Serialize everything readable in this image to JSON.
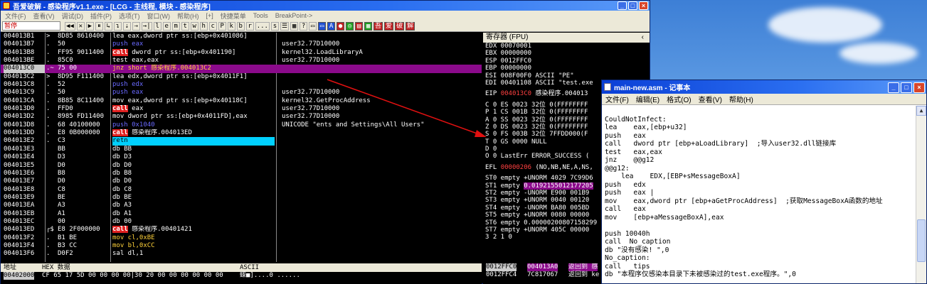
{
  "olly": {
    "title": "吾爱破解 - 感染程序v1.1.exe - [LCG - 主线程, 模块 - 感染程序]",
    "menu": [
      "文件(F)",
      "查看(V)",
      "调试(D)",
      "插件(P)",
      "选项(T)",
      "窗口(W)",
      "帮助(H)",
      "[+]",
      "快捷菜单",
      "Tools",
      "BreakPoint->"
    ],
    "status": "暂停",
    "toolbar": [
      "◀◀",
      "✕",
      "▶",
      "⏸",
      "↳",
      "↴",
      "⇣",
      "⇢",
      "→|",
      "l",
      "e",
      "m",
      "t",
      "w",
      "h",
      "c",
      "P",
      "k",
      "b",
      "r",
      "...",
      "s",
      "☰",
      "▦",
      "?",
      "▭",
      "▭",
      "A",
      "●",
      "◎",
      "▤",
      "▦",
      "吾",
      "爱",
      "破",
      "解"
    ],
    "disasm": [
      {
        "addr": "004013B1",
        "mk": ">",
        "hex": "8D85 8610400",
        "asm": "lea eax,dword ptr ss:[ebp+0x401086]",
        "cmt": ""
      },
      {
        "addr": "004013B7",
        "mk": ".",
        "hex": "50",
        "asm": "push eax",
        "cmt": "user32.77D10000"
      },
      {
        "addr": "004013B8",
        "mk": ".",
        "hex": "FF95 9011400",
        "asm": "call dword ptr ss:[ebp+0x401190]",
        "cmt": "kernel32.LoadLibraryA"
      },
      {
        "addr": "004013BE",
        "mk": ".",
        "hex": "85C0",
        "asm": "test eax,eax",
        "cmt": "user32.77D10000"
      },
      {
        "addr": "004013C0",
        "mk": ".~",
        "hex": "75 00",
        "asm": "jnz short 感染程序.004013C2",
        "cmt": ""
      },
      {
        "addr": "004013C2",
        "mk": ">",
        "hex": "8D95 F111400",
        "asm": "lea edx,dword ptr ss:[ebp+0x4011F1]",
        "cmt": ""
      },
      {
        "addr": "004013C8",
        "mk": ".",
        "hex": "52",
        "asm": "push edx",
        "cmt": ""
      },
      {
        "addr": "004013C9",
        "mk": ".",
        "hex": "50",
        "asm": "push eax",
        "cmt": "user32.77D10000"
      },
      {
        "addr": "004013CA",
        "mk": ".",
        "hex": "8B85 8C11400",
        "asm": "mov eax,dword ptr ss:[ebp+0x40118C]",
        "cmt": "kernel32.GetProcAddress"
      },
      {
        "addr": "004013D0",
        "mk": ".",
        "hex": "FFD0",
        "asm": "call eax",
        "cmt": "user32.77D10000"
      },
      {
        "addr": "004013D2",
        "mk": ".",
        "hex": "8985 FD11400",
        "asm": "mov dword ptr ss:[ebp+0x4011FD],eax",
        "cmt": "user32.77D10000"
      },
      {
        "addr": "004013D8",
        "mk": ".",
        "hex": "68 40100000",
        "asm": "push 0x1040",
        "cmt": "UNICODE \"ents and Settings\\All Users\""
      },
      {
        "addr": "004013DD",
        "mk": ".",
        "hex": "E8 0B000000",
        "asm": "call 感染程序.004013ED",
        "cmt": ""
      },
      {
        "addr": "004013E2",
        "mk": ".",
        "hex": "C3",
        "asm": "retn",
        "cmt": ""
      },
      {
        "addr": "004013E3",
        "mk": "",
        "hex": "BB",
        "asm": "db BB",
        "cmt": ""
      },
      {
        "addr": "004013E4",
        "mk": "",
        "hex": "D3",
        "asm": "db D3",
        "cmt": ""
      },
      {
        "addr": "004013E5",
        "mk": "",
        "hex": "D0",
        "asm": "db D0",
        "cmt": ""
      },
      {
        "addr": "004013E6",
        "mk": "",
        "hex": "B8",
        "asm": "db B8",
        "cmt": ""
      },
      {
        "addr": "004013E7",
        "mk": "",
        "hex": "D0",
        "asm": "db D0",
        "cmt": ""
      },
      {
        "addr": "004013E8",
        "mk": "",
        "hex": "C8",
        "asm": "db C8",
        "cmt": ""
      },
      {
        "addr": "004013E9",
        "mk": "",
        "hex": "BE",
        "asm": "db BE",
        "cmt": ""
      },
      {
        "addr": "004013EA",
        "mk": "",
        "hex": "A3",
        "asm": "db A3",
        "cmt": ""
      },
      {
        "addr": "004013EB",
        "mk": "",
        "hex": "A1",
        "asm": "db A1",
        "cmt": ""
      },
      {
        "addr": "004013EC",
        "mk": "",
        "hex": "00",
        "asm": "db 00",
        "cmt": ""
      },
      {
        "addr": "004013ED",
        "mk": "┌$",
        "hex": "E8 2F000000",
        "asm": "call 感染程序.00401421",
        "cmt": ""
      },
      {
        "addr": "004013F2",
        "mk": ".",
        "hex": "B1 BE",
        "asm": "mov cl,0xBE",
        "cmt": ""
      },
      {
        "addr": "004013F4",
        "mk": ".",
        "hex": "B3 CC",
        "asm": "mov bl,0xCC",
        "cmt": ""
      },
      {
        "addr": "004013F6",
        "mk": ".",
        "hex": "D0F2",
        "asm": "sal dl,1",
        "cmt": ""
      }
    ],
    "regs_title": "寄存器 (FPU)",
    "regs": [
      "EDX 00070001",
      "EBX 00000000",
      "ESP 0012FFC0",
      "EBP 00000000",
      "ESI 008F00F0 ASCII \"PE\"",
      "EDI 00401108 ASCII \"test.exe",
      "",
      "EIP 004013C0 感染程序.004013",
      "",
      "C 0  ES 0023 32位 0(FFFFFFFF",
      "P 1  CS 001B 32位 0(FFFFFFFF",
      "A 0  SS 0023 32位 0(FFFFFFFF",
      "Z 0  DS 0023 32位 0(FFFFFFFF",
      "S 0  FS 003B 32位 7FFDD000(F",
      "T 0  GS 0000 NULL",
      "D 0",
      "O 0  LastErr ERROR_SUCCESS (",
      "",
      "EFL 00000206 (NO,NB,NE,A,NS,",
      "",
      "ST0 empty +UNORM 4029 7C99D6",
      "ST1 empty 0.0192155012177205",
      "ST2 empty -UNORM E900 001B9",
      "ST3 empty +UNORM 0040 00120",
      "ST4 empty -UNORM BA80 005BD",
      "ST5 empty +UNORM 0080 00000",
      "ST6 empty 0.00000200807158299",
      "ST7 empty +UNORM 405C 00000",
      "              3 2 1 0"
    ],
    "dump": {
      "h_addr": "地址",
      "h_hex": "HEX 数据",
      "h_ascii": "ASCII",
      "addr": "00402000",
      "hex": "CF 65 17 5D 00 00 00 00|30 20 00 00 00 00 00 00",
      "ascii": "蟝■]....0 ......"
    },
    "stack": [
      {
        "addr": "0012FFC0",
        "val": "004013A0",
        "txt": "返回到 感"
      },
      {
        "addr": "0012FFC4",
        "val": "7C817067",
        "txt": "返回到 ke"
      }
    ]
  },
  "notepad": {
    "title": "main-new.asm - 记事本",
    "menu": [
      "文件(F)",
      "编辑(E)",
      "格式(O)",
      "查看(V)",
      "帮助(H)"
    ],
    "lines": [
      "",
      "CouldNotInfect:",
      "lea    eax,[ebp+u32]",
      "push   eax",
      "call   dword ptr [ebp+aLoadLibrary]  ;导入user32.dll链接库",
      "test   eax,eax",
      "jnz    @@g12",
      "@@g12:",
      "    lea    EDX,[EBP+sMessageBoxA]",
      "push   edx",
      "push   eax |",
      "mov    eax,dword ptr [ebp+aGetProcAddress]  ;获取MessageBoxA函数的地址",
      "call   eax",
      "mov    [ebp+aMessageBoxA],eax",
      "",
      "push 10040h",
      "call  No_caption",
      "db \"没有感染! \",0",
      "No_caption:",
      "call  _tips",
      "db \"本程序仅感染本目录下未被感染过的test.exe程序。\",0"
    ]
  }
}
